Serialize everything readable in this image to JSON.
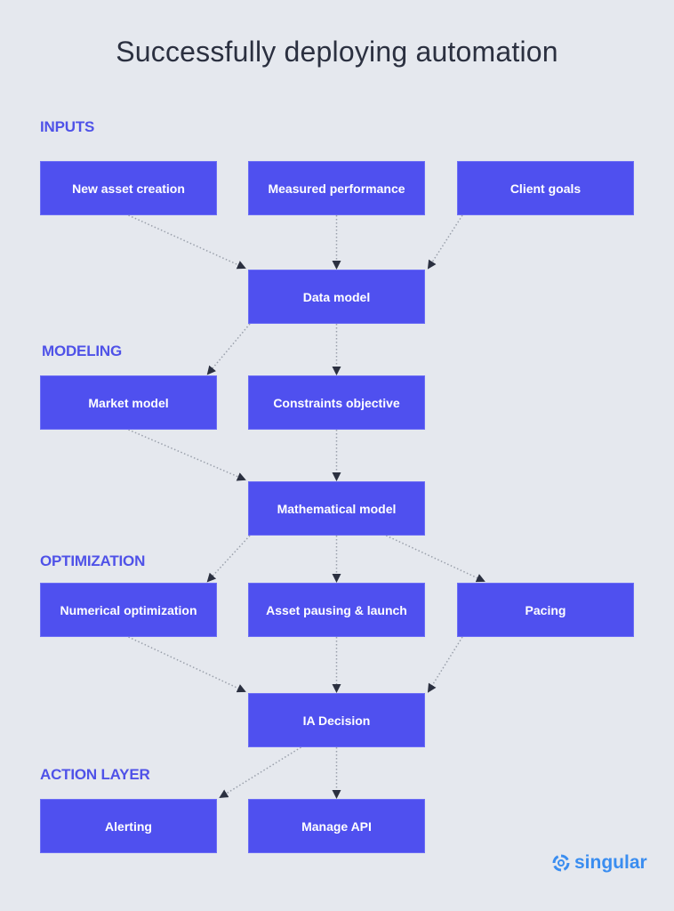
{
  "title": "Successfully deploying automation",
  "sections": {
    "inputs": "INPUTS",
    "modeling": "MODELING",
    "optimization": "OPTIMIZATION",
    "action_layer": "ACTION LAYER"
  },
  "nodes": {
    "new_asset_creation": "New asset creation",
    "measured_performance": "Measured performance",
    "client_goals": "Client goals",
    "data_model": "Data model",
    "market_model": "Market model",
    "constraints_objective": "Constraints objective",
    "mathematical_model": "Mathematical model",
    "numerical_optimization": "Numerical optimization",
    "asset_pausing_launch": "Asset pausing & launch",
    "pacing": "Pacing",
    "ia_decision": "IA Decision",
    "alerting": "Alerting",
    "manage_api": "Manage API"
  },
  "edges": [
    [
      "new_asset_creation",
      "data_model"
    ],
    [
      "measured_performance",
      "data_model"
    ],
    [
      "client_goals",
      "data_model"
    ],
    [
      "data_model",
      "market_model"
    ],
    [
      "data_model",
      "constraints_objective"
    ],
    [
      "market_model",
      "mathematical_model"
    ],
    [
      "constraints_objective",
      "mathematical_model"
    ],
    [
      "mathematical_model",
      "numerical_optimization"
    ],
    [
      "mathematical_model",
      "asset_pausing_launch"
    ],
    [
      "mathematical_model",
      "pacing"
    ],
    [
      "numerical_optimization",
      "ia_decision"
    ],
    [
      "asset_pausing_launch",
      "ia_decision"
    ],
    [
      "pacing",
      "ia_decision"
    ],
    [
      "ia_decision",
      "alerting"
    ],
    [
      "ia_decision",
      "manage_api"
    ]
  ],
  "logo": {
    "text": "singular",
    "icon": "singular-swirl-icon"
  },
  "colors": {
    "box": "#4f50ef",
    "section": "#4f52e8",
    "title": "#2b3040",
    "background": "#e5e8ee",
    "logo": "#3a8df0"
  }
}
